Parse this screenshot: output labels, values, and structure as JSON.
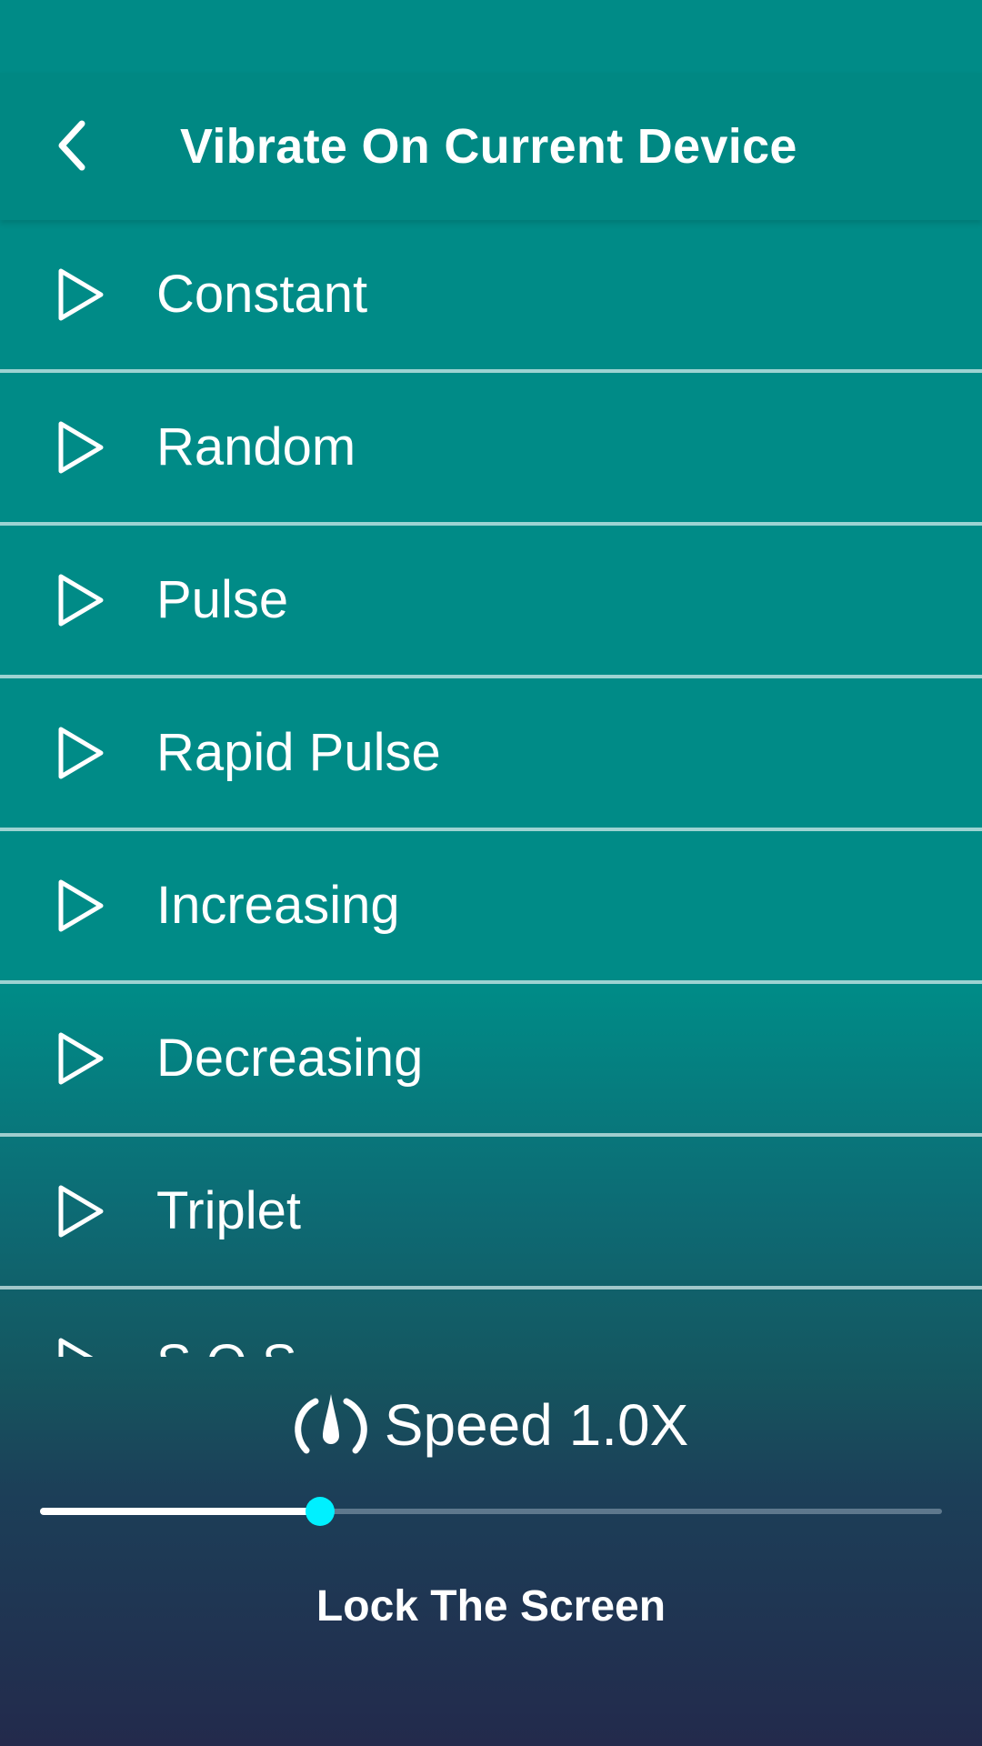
{
  "header": {
    "title": "Vibrate On Current Device",
    "back_icon": "back-chevron-icon"
  },
  "patterns": [
    {
      "label": "Constant",
      "icon": "play-outline-icon"
    },
    {
      "label": "Random",
      "icon": "play-outline-icon"
    },
    {
      "label": "Pulse",
      "icon": "play-outline-icon"
    },
    {
      "label": "Rapid Pulse",
      "icon": "play-outline-icon"
    },
    {
      "label": "Increasing",
      "icon": "play-outline-icon"
    },
    {
      "label": "Decreasing",
      "icon": "play-outline-icon"
    },
    {
      "label": "Triplet",
      "icon": "play-outline-icon"
    },
    {
      "label": "S.O.S",
      "icon": "play-outline-icon"
    }
  ],
  "speed": {
    "label": "Speed 1.0X",
    "icon": "speedometer-icon",
    "slider_fraction": 0.31
  },
  "lock_button": {
    "label": "Lock The Screen"
  },
  "colors": {
    "background_top": "#008b87",
    "background_bottom": "#232a4c",
    "slider_thumb": "#00f0ff",
    "text": "#ffffff"
  }
}
